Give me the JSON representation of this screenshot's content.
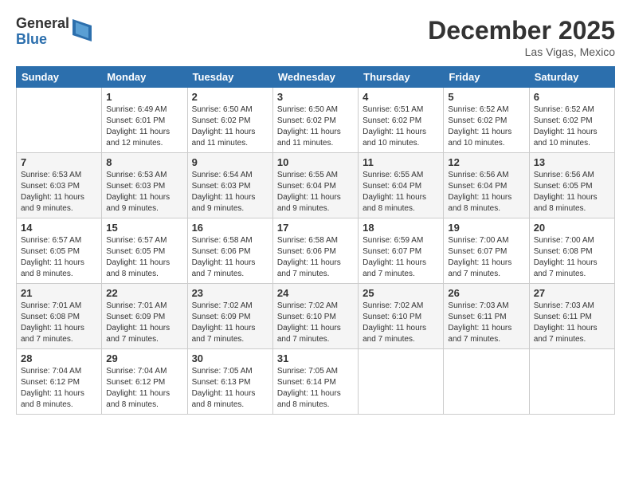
{
  "logo": {
    "general": "General",
    "blue": "Blue"
  },
  "title": {
    "month": "December 2025",
    "location": "Las Vigas, Mexico"
  },
  "headers": [
    "Sunday",
    "Monday",
    "Tuesday",
    "Wednesday",
    "Thursday",
    "Friday",
    "Saturday"
  ],
  "weeks": [
    [
      {
        "day": "",
        "info": ""
      },
      {
        "day": "1",
        "info": "Sunrise: 6:49 AM\nSunset: 6:01 PM\nDaylight: 11 hours\nand 12 minutes."
      },
      {
        "day": "2",
        "info": "Sunrise: 6:50 AM\nSunset: 6:02 PM\nDaylight: 11 hours\nand 11 minutes."
      },
      {
        "day": "3",
        "info": "Sunrise: 6:50 AM\nSunset: 6:02 PM\nDaylight: 11 hours\nand 11 minutes."
      },
      {
        "day": "4",
        "info": "Sunrise: 6:51 AM\nSunset: 6:02 PM\nDaylight: 11 hours\nand 10 minutes."
      },
      {
        "day": "5",
        "info": "Sunrise: 6:52 AM\nSunset: 6:02 PM\nDaylight: 11 hours\nand 10 minutes."
      },
      {
        "day": "6",
        "info": "Sunrise: 6:52 AM\nSunset: 6:02 PM\nDaylight: 11 hours\nand 10 minutes."
      }
    ],
    [
      {
        "day": "7",
        "info": "Sunrise: 6:53 AM\nSunset: 6:03 PM\nDaylight: 11 hours\nand 9 minutes."
      },
      {
        "day": "8",
        "info": "Sunrise: 6:53 AM\nSunset: 6:03 PM\nDaylight: 11 hours\nand 9 minutes."
      },
      {
        "day": "9",
        "info": "Sunrise: 6:54 AM\nSunset: 6:03 PM\nDaylight: 11 hours\nand 9 minutes."
      },
      {
        "day": "10",
        "info": "Sunrise: 6:55 AM\nSunset: 6:04 PM\nDaylight: 11 hours\nand 9 minutes."
      },
      {
        "day": "11",
        "info": "Sunrise: 6:55 AM\nSunset: 6:04 PM\nDaylight: 11 hours\nand 8 minutes."
      },
      {
        "day": "12",
        "info": "Sunrise: 6:56 AM\nSunset: 6:04 PM\nDaylight: 11 hours\nand 8 minutes."
      },
      {
        "day": "13",
        "info": "Sunrise: 6:56 AM\nSunset: 6:05 PM\nDaylight: 11 hours\nand 8 minutes."
      }
    ],
    [
      {
        "day": "14",
        "info": "Sunrise: 6:57 AM\nSunset: 6:05 PM\nDaylight: 11 hours\nand 8 minutes."
      },
      {
        "day": "15",
        "info": "Sunrise: 6:57 AM\nSunset: 6:05 PM\nDaylight: 11 hours\nand 8 minutes."
      },
      {
        "day": "16",
        "info": "Sunrise: 6:58 AM\nSunset: 6:06 PM\nDaylight: 11 hours\nand 7 minutes."
      },
      {
        "day": "17",
        "info": "Sunrise: 6:58 AM\nSunset: 6:06 PM\nDaylight: 11 hours\nand 7 minutes."
      },
      {
        "day": "18",
        "info": "Sunrise: 6:59 AM\nSunset: 6:07 PM\nDaylight: 11 hours\nand 7 minutes."
      },
      {
        "day": "19",
        "info": "Sunrise: 7:00 AM\nSunset: 6:07 PM\nDaylight: 11 hours\nand 7 minutes."
      },
      {
        "day": "20",
        "info": "Sunrise: 7:00 AM\nSunset: 6:08 PM\nDaylight: 11 hours\nand 7 minutes."
      }
    ],
    [
      {
        "day": "21",
        "info": "Sunrise: 7:01 AM\nSunset: 6:08 PM\nDaylight: 11 hours\nand 7 minutes."
      },
      {
        "day": "22",
        "info": "Sunrise: 7:01 AM\nSunset: 6:09 PM\nDaylight: 11 hours\nand 7 minutes."
      },
      {
        "day": "23",
        "info": "Sunrise: 7:02 AM\nSunset: 6:09 PM\nDaylight: 11 hours\nand 7 minutes."
      },
      {
        "day": "24",
        "info": "Sunrise: 7:02 AM\nSunset: 6:10 PM\nDaylight: 11 hours\nand 7 minutes."
      },
      {
        "day": "25",
        "info": "Sunrise: 7:02 AM\nSunset: 6:10 PM\nDaylight: 11 hours\nand 7 minutes."
      },
      {
        "day": "26",
        "info": "Sunrise: 7:03 AM\nSunset: 6:11 PM\nDaylight: 11 hours\nand 7 minutes."
      },
      {
        "day": "27",
        "info": "Sunrise: 7:03 AM\nSunset: 6:11 PM\nDaylight: 11 hours\nand 7 minutes."
      }
    ],
    [
      {
        "day": "28",
        "info": "Sunrise: 7:04 AM\nSunset: 6:12 PM\nDaylight: 11 hours\nand 8 minutes."
      },
      {
        "day": "29",
        "info": "Sunrise: 7:04 AM\nSunset: 6:12 PM\nDaylight: 11 hours\nand 8 minutes."
      },
      {
        "day": "30",
        "info": "Sunrise: 7:05 AM\nSunset: 6:13 PM\nDaylight: 11 hours\nand 8 minutes."
      },
      {
        "day": "31",
        "info": "Sunrise: 7:05 AM\nSunset: 6:14 PM\nDaylight: 11 hours\nand 8 minutes."
      },
      {
        "day": "",
        "info": ""
      },
      {
        "day": "",
        "info": ""
      },
      {
        "day": "",
        "info": ""
      }
    ]
  ]
}
